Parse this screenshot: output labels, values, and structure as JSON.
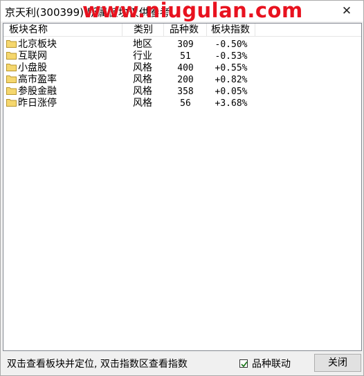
{
  "window": {
    "title": "京天利(300399) 所属板块仅供参考",
    "watermark": "www.niugulan.com"
  },
  "table": {
    "headers": {
      "name": "板块名称",
      "type": "类别",
      "count": "品种数",
      "index": "板块指数"
    },
    "rows": [
      {
        "name": "北京板块",
        "type": "地区",
        "count": "309",
        "index": "-0.50%"
      },
      {
        "name": "互联网",
        "type": "行业",
        "count": "51",
        "index": "-0.53%"
      },
      {
        "name": "小盘股",
        "type": "风格",
        "count": "400",
        "index": "+0.55%"
      },
      {
        "name": "高市盈率",
        "type": "风格",
        "count": "200",
        "index": "+0.82%"
      },
      {
        "name": "参股金融",
        "type": "风格",
        "count": "358",
        "index": "+0.05%"
      },
      {
        "name": "昨日涨停",
        "type": "风格",
        "count": "56",
        "index": "+3.68%"
      }
    ]
  },
  "footer": {
    "hint": "双击查看板块并定位, 双击指数区查看指数",
    "checkbox_label": "品种联动",
    "checkbox_checked": true,
    "close_label": "关闭"
  },
  "icons": {
    "row_icon": "folder-icon",
    "close": "close-icon",
    "check": "check-icon"
  },
  "colors": {
    "watermark": "#e8121f",
    "folder": "#f5d76e",
    "check": "#1f7a1f"
  }
}
